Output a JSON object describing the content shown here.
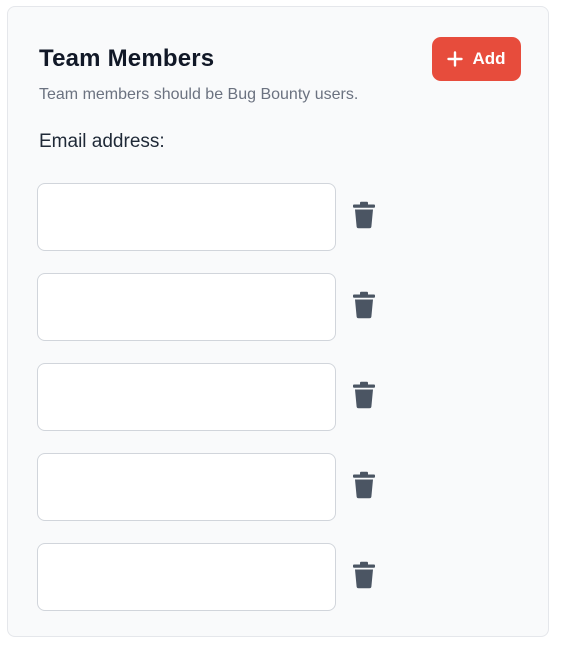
{
  "header": {
    "title": "Team Members",
    "subtitle": "Team members should be Bug Bounty users.",
    "add_button_label": "Add",
    "add_icon": "plus-icon"
  },
  "form": {
    "email_label": "Email address:",
    "delete_icon": "trash-icon",
    "rows": [
      {
        "value": "",
        "placeholder": ""
      },
      {
        "value": "",
        "placeholder": ""
      },
      {
        "value": "",
        "placeholder": ""
      },
      {
        "value": "",
        "placeholder": ""
      },
      {
        "value": "",
        "placeholder": ""
      }
    ]
  },
  "colors": {
    "accent": "#e74c3c",
    "icon": "#4b5563",
    "card_bg": "#f9fafb",
    "border": "#d1d5db"
  }
}
